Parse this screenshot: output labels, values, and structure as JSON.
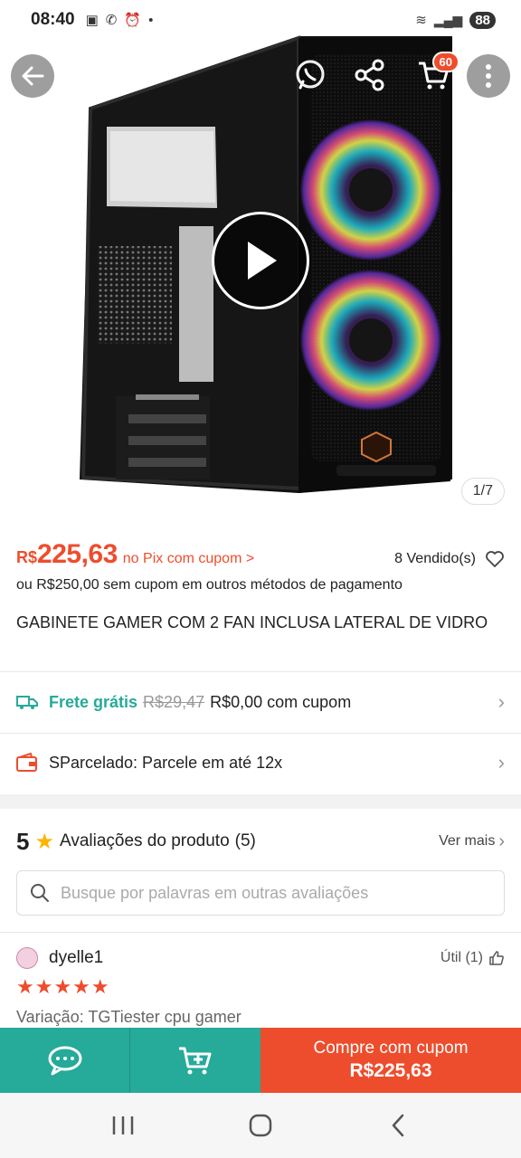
{
  "status_bar": {
    "time": "08:40",
    "battery": "88"
  },
  "hero": {
    "cart_count": "60",
    "image_counter": "1/7"
  },
  "price": {
    "currency": "R$",
    "value": "225,63",
    "pix_text": "no Pix com cupom >",
    "sold": "8 Vendido(s)",
    "alt_text": "ou R$250,00 sem cupom em outros métodos de pagamento"
  },
  "product": {
    "title": "GABINETE GAMER COM 2 FAN INCLUSA LATERAL DE VIDRO"
  },
  "shipping": {
    "label": "Frete grátis",
    "old_price": "R$29,47",
    "value": "R$0,00 com cupom"
  },
  "installments": {
    "text": "SParcelado: Parcele em até 12x"
  },
  "reviews": {
    "score": "5",
    "title": "Avaliações do produto",
    "count": "(5)",
    "see_more": "Ver mais",
    "search_placeholder": "Busque por palavras em outras avaliações",
    "items": [
      {
        "username": "dyelle1",
        "useful": "Útil (1)",
        "stars": "★★★★★",
        "variation": "Variação: TGTiester cpu gamer"
      }
    ]
  },
  "bottom_bar": {
    "buy_label": "Compre com cupom",
    "buy_price": "R$225,63"
  },
  "colors": {
    "accent": "#ee4d2d",
    "teal": "#26aa99",
    "star": "#ffb400"
  }
}
